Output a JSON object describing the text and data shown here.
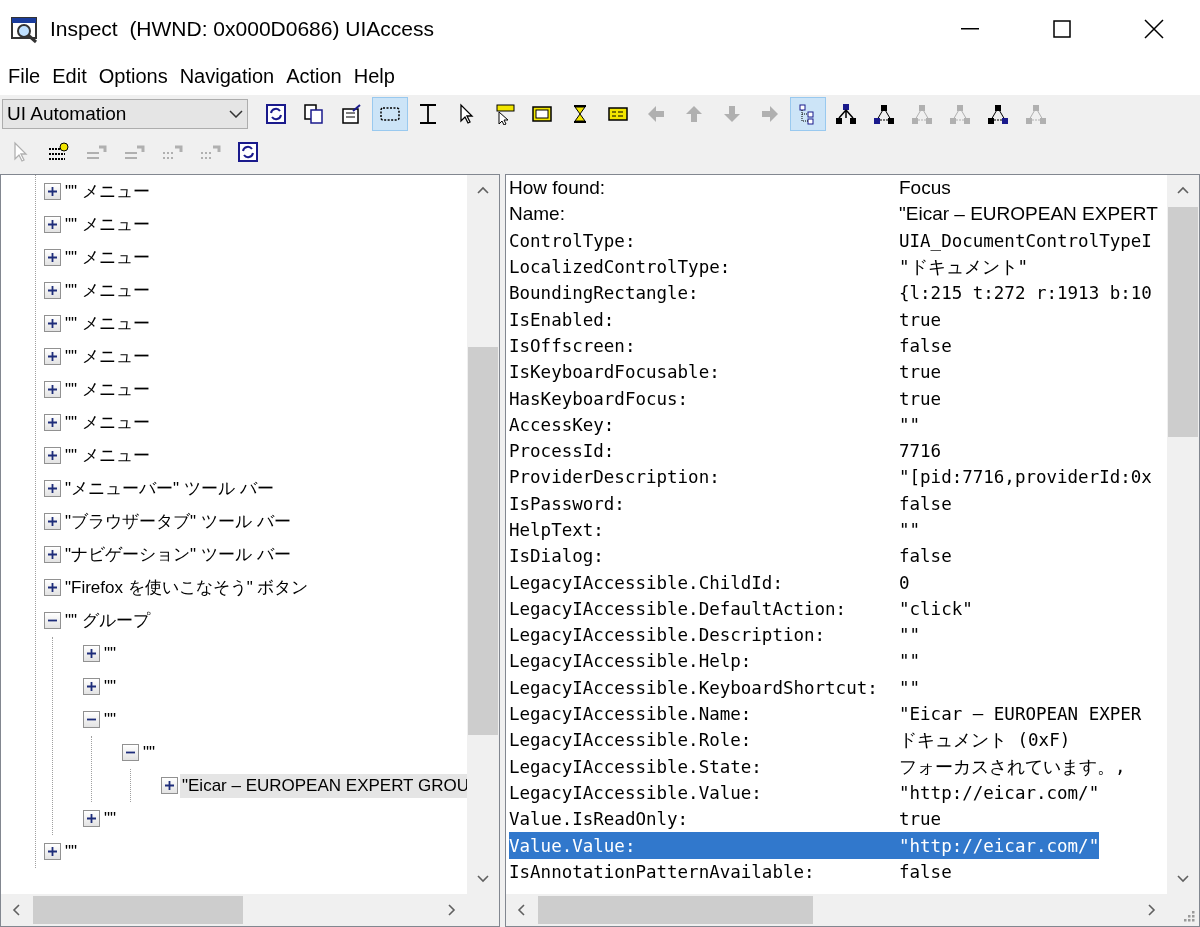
{
  "window": {
    "title": "Inspect  (HWND: 0x000D0686) UIAccess"
  },
  "menu": [
    "File",
    "Edit",
    "Options",
    "Navigation",
    "Action",
    "Help"
  ],
  "toolbar": {
    "mode_dropdown": {
      "value": "UI Automation"
    },
    "buttons": [
      {
        "kind": "refresh",
        "disabled": false,
        "pressed": false
      },
      {
        "kind": "copy",
        "disabled": false,
        "pressed": false
      },
      {
        "kind": "clipboard",
        "disabled": false,
        "pressed": false
      },
      {
        "kind": "selection",
        "disabled": false,
        "pressed": true
      },
      {
        "kind": "text-cursor",
        "disabled": false,
        "pressed": false
      },
      {
        "kind": "pointer",
        "disabled": false,
        "pressed": false
      },
      {
        "kind": "pointer-tooltip",
        "disabled": false,
        "pressed": false
      },
      {
        "kind": "window",
        "disabled": false,
        "pressed": false
      },
      {
        "kind": "hourglass",
        "disabled": false,
        "pressed": false
      },
      {
        "kind": "panel",
        "disabled": false,
        "pressed": false
      },
      {
        "kind": "arrow-left",
        "disabled": true,
        "pressed": false
      },
      {
        "kind": "arrow-up",
        "disabled": true,
        "pressed": false
      },
      {
        "kind": "arrow-down",
        "disabled": true,
        "pressed": false
      },
      {
        "kind": "arrow-right",
        "disabled": true,
        "pressed": false
      },
      {
        "kind": "tree",
        "disabled": false,
        "pressed": true
      },
      {
        "kind": "parent",
        "disabled": false,
        "pressed": false
      },
      {
        "kind": "first-child",
        "disabled": false,
        "pressed": false
      },
      {
        "kind": "previous-sibling",
        "disabled": true,
        "pressed": false
      },
      {
        "kind": "next-sibling",
        "disabled": true,
        "pressed": false
      },
      {
        "kind": "last-child",
        "disabled": false,
        "pressed": false
      },
      {
        "kind": "all-nodes",
        "disabled": true,
        "pressed": false
      }
    ]
  },
  "toolbar_2": {
    "buttons": [
      {
        "kind": "hand-pointer",
        "disabled": true,
        "pressed": false
      },
      {
        "kind": "list-star",
        "disabled": false,
        "pressed": false
      },
      {
        "kind": "action",
        "disabled": true,
        "pressed": false
      },
      {
        "kind": "list-action",
        "disabled": true,
        "pressed": false
      },
      {
        "kind": "dotted-action",
        "disabled": true,
        "pressed": false
      },
      {
        "kind": "dotted-action",
        "disabled": true,
        "pressed": false
      },
      {
        "kind": "refresh",
        "disabled": false,
        "pressed": false
      }
    ]
  },
  "tree": [
    {
      "label": "\"\" メニュー",
      "expanded": false,
      "selected": false
    },
    {
      "label": "\"\" メニュー",
      "expanded": false,
      "selected": false
    },
    {
      "label": "\"\" メニュー",
      "expanded": false,
      "selected": false
    },
    {
      "label": "\"\" メニュー",
      "expanded": false,
      "selected": false
    },
    {
      "label": "\"\" メニュー",
      "expanded": false,
      "selected": false
    },
    {
      "label": "\"\" メニュー",
      "expanded": false,
      "selected": false
    },
    {
      "label": "\"\" メニュー",
      "expanded": false,
      "selected": false
    },
    {
      "label": "\"\" メニュー",
      "expanded": false,
      "selected": false
    },
    {
      "label": "\"\" メニュー",
      "expanded": false,
      "selected": false
    },
    {
      "label": "\"メニューバー\" ツール バー",
      "expanded": false,
      "selected": false
    },
    {
      "label": "\"ブラウザータブ\" ツール バー",
      "expanded": false,
      "selected": false
    },
    {
      "label": "\"ナビゲーション\" ツール バー",
      "expanded": false,
      "selected": false
    },
    {
      "label": "\"Firefox を使いこなそう\" ボタン",
      "expanded": false,
      "selected": false
    },
    {
      "label": "\"\" グループ",
      "expanded": true,
      "selected": false,
      "children": [
        {
          "label": "\"\"",
          "expanded": false,
          "selected": false
        },
        {
          "label": "\"\"",
          "expanded": false,
          "selected": false
        },
        {
          "label": "\"\"",
          "expanded": true,
          "selected": false,
          "children": [
            {
              "label": "\"\"",
              "expanded": true,
              "selected": false,
              "children": [
                {
                  "label": "\"Eicar – EUROPEAN EXPERT GROU",
                  "expanded": false,
                  "selected": true
                }
              ]
            }
          ]
        },
        {
          "label": "\"\"",
          "expanded": false,
          "selected": false
        }
      ]
    },
    {
      "label": "\"\"",
      "expanded": false,
      "selected": false
    }
  ],
  "properties": [
    {
      "kind": "summary",
      "name": "How found:",
      "value": "Focus",
      "selected": false
    },
    {
      "kind": "summary",
      "name": "Name:",
      "value": "\"Eicar – EUROPEAN EXPERT",
      "selected": false
    },
    {
      "kind": "property",
      "name": "ControlType:",
      "value": "UIA_DocumentControlTypeI",
      "selected": false
    },
    {
      "kind": "property",
      "name": "LocalizedControlType:",
      "value": "\"ドキュメント\"",
      "selected": false
    },
    {
      "kind": "property",
      "name": "BoundingRectangle:",
      "value": "{l:215 t:272 r:1913 b:10",
      "selected": false
    },
    {
      "kind": "property",
      "name": "IsEnabled:",
      "value": "true",
      "selected": false
    },
    {
      "kind": "property",
      "name": "IsOffscreen:",
      "value": "false",
      "selected": false
    },
    {
      "kind": "property",
      "name": "IsKeyboardFocusable:",
      "value": "true",
      "selected": false
    },
    {
      "kind": "property",
      "name": "HasKeyboardFocus:",
      "value": "true",
      "selected": false
    },
    {
      "kind": "property",
      "name": "AccessKey:",
      "value": "\"\"",
      "selected": false
    },
    {
      "kind": "property",
      "name": "ProcessId:",
      "value": "7716",
      "selected": false
    },
    {
      "kind": "property",
      "name": "ProviderDescription:",
      "value": "\"[pid:7716,providerId:0x",
      "selected": false
    },
    {
      "kind": "property",
      "name": "IsPassword:",
      "value": "false",
      "selected": false
    },
    {
      "kind": "property",
      "name": "HelpText:",
      "value": "\"\"",
      "selected": false
    },
    {
      "kind": "property",
      "name": "IsDialog:",
      "value": "false",
      "selected": false
    },
    {
      "kind": "property",
      "name": "LegacyIAccessible.ChildId:",
      "value": "0",
      "selected": false
    },
    {
      "kind": "property",
      "name": "LegacyIAccessible.DefaultAction:",
      "value": "\"click\"",
      "selected": false
    },
    {
      "kind": "property",
      "name": "LegacyIAccessible.Description:",
      "value": "\"\"",
      "selected": false
    },
    {
      "kind": "property",
      "name": "LegacyIAccessible.Help:",
      "value": "\"\"",
      "selected": false
    },
    {
      "kind": "property",
      "name": "LegacyIAccessible.KeyboardShortcut:",
      "value": "\"\"",
      "selected": false
    },
    {
      "kind": "property",
      "name": "LegacyIAccessible.Name:",
      "value": "\"Eicar – EUROPEAN EXPER",
      "selected": false
    },
    {
      "kind": "property",
      "name": "LegacyIAccessible.Role:",
      "value": "ドキュメント (0xF)",
      "selected": false
    },
    {
      "kind": "property",
      "name": "LegacyIAccessible.State:",
      "value": "フォーカスされています。,",
      "selected": false
    },
    {
      "kind": "property",
      "name": "LegacyIAccessible.Value:",
      "value": "\"http://eicar.com/\"",
      "selected": false
    },
    {
      "kind": "property",
      "name": "Value.IsReadOnly:",
      "value": "true",
      "selected": false
    },
    {
      "kind": "property",
      "name": "Value.Value:",
      "value": "\"http://eicar.com/\"",
      "selected": true
    },
    {
      "kind": "property",
      "name": "IsAnnotationPatternAvailable:",
      "value": "false",
      "selected": false
    }
  ]
}
